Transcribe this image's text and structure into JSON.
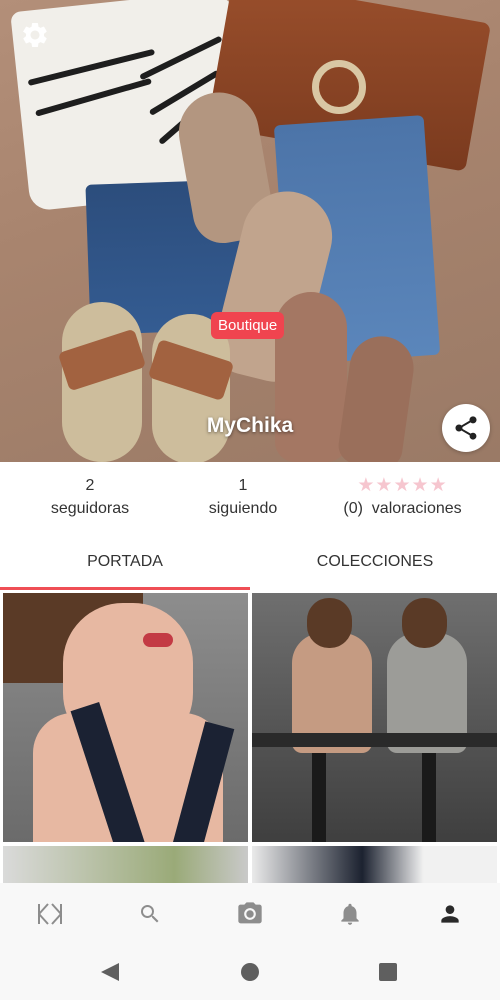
{
  "profile": {
    "badge": "Boutique",
    "name": "MyChika"
  },
  "stats": {
    "followers_count": "2",
    "followers_label": "seguidoras",
    "following_count": "1",
    "following_label": "siguiendo",
    "rating_stars": 0,
    "rating_max": 5,
    "ratings_text": "(0)  valoraciones"
  },
  "tabs": [
    {
      "label": "PORTADA",
      "active": true
    },
    {
      "label": "COLECCIONES",
      "active": false
    }
  ],
  "icons": {
    "settings": "gear-icon",
    "share": "share-icon",
    "nav": [
      "logo-icon",
      "search-icon",
      "camera-icon",
      "bell-icon",
      "person-icon"
    ],
    "system": [
      "back-icon",
      "home-icon",
      "recents-icon"
    ]
  },
  "colors": {
    "accent": "#ef4e55",
    "badge": "#f0444f",
    "star_empty": "#f6c6cf",
    "nav_inactive": "#8d8d8d",
    "nav_active": "#2a2a2a"
  }
}
